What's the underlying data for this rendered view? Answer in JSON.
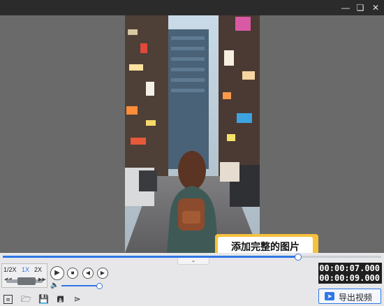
{
  "window": {
    "minimize_icon": "minimize-icon",
    "maximize_icon": "restore-icon",
    "close_icon": "close-icon"
  },
  "preview": {
    "caption": "添加完整的图片",
    "caption_highlight_color": "#f6c23c"
  },
  "timeline": {
    "progress": 0.78
  },
  "speed": {
    "options": [
      "1/2X",
      "1X",
      "2X"
    ],
    "selected": "1X"
  },
  "playback": {
    "play_icon": "play-icon",
    "stop_icon": "stop-icon",
    "prev_frame_icon": "prev-frame-icon",
    "next_frame_icon": "next-frame-icon"
  },
  "volume": {
    "level": 0.96
  },
  "time": {
    "current": "00:00:07.000",
    "total": "00:00:09.000"
  },
  "toolbar": {
    "icons": [
      "crop-icon",
      "folder-icon",
      "save-icon",
      "save-as-icon",
      "share-icon"
    ],
    "export_label": "导出视频"
  },
  "colors": {
    "accent": "#2f76e6",
    "background": "#6a6a6a"
  }
}
